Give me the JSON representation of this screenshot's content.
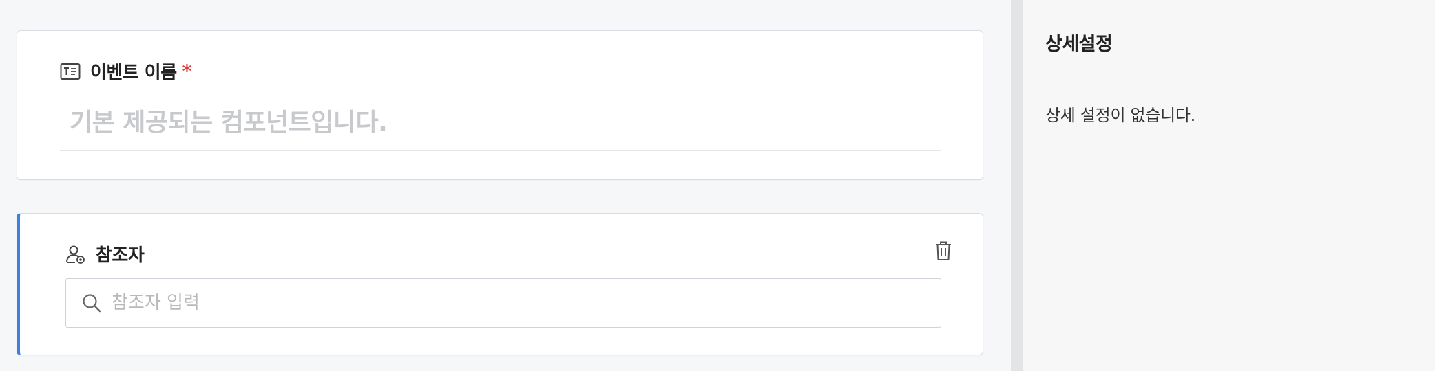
{
  "form": {
    "fields": [
      {
        "icon": "text-field-icon",
        "label": "이벤트 이름",
        "required_mark": "*",
        "placeholder": "기본 제공되는 컴포넌트입니다."
      },
      {
        "icon": "participant-icon",
        "label": "참조자",
        "search_icon": "search-icon",
        "search_placeholder": "참조자 입력",
        "delete_icon": "trash-icon",
        "accent_color": "#3b82e0"
      }
    ]
  },
  "settings_panel": {
    "title": "상세설정",
    "empty_message": "상세 설정이 없습니다."
  },
  "colors": {
    "required": "#e03a3a",
    "accent": "#3b82e0",
    "placeholder": "#c8c9cc"
  }
}
